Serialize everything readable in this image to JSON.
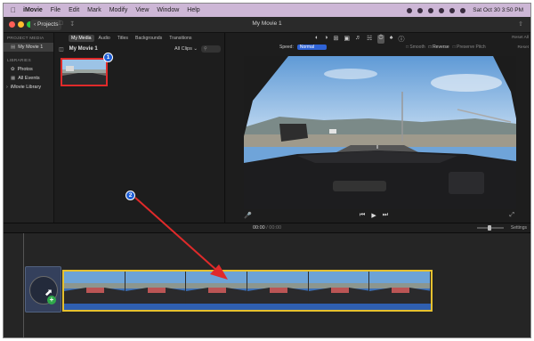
{
  "menubar": {
    "apple_icon": "apple-icon",
    "items": [
      "iMovie",
      "File",
      "Edit",
      "Mark",
      "Modify",
      "View",
      "Window",
      "Help"
    ],
    "clock": "Sat Oct 30  3:50 PM"
  },
  "titlebar": {
    "projects": "Projects",
    "title": "My Movie 1"
  },
  "sidebar": {
    "project_media_header": "PROJECT MEDIA",
    "project_item": "My Movie 1",
    "libraries_header": "LIBRARIES",
    "library_items": [
      "Photos",
      "All Events",
      "iMovie Library"
    ]
  },
  "browser": {
    "tabs": [
      "My Media",
      "Audio",
      "Titles",
      "Backgrounds",
      "Transitions"
    ],
    "title": "My Movie 1",
    "filter": "All Clips",
    "badge": "1"
  },
  "viewer": {
    "reset_all": "Reset All",
    "speed_label": "Speed:",
    "speed_value": "Normal",
    "options": [
      "Smooth",
      "Reverse",
      "Preserve Pitch"
    ],
    "reset": "Reset"
  },
  "timeline": {
    "timecode_current": "00:00",
    "timecode_total": "00:00",
    "settings": "Settings",
    "badge": "2"
  },
  "colors": {
    "menubar": "#cdb7d6",
    "selection_red": "#e02a2a",
    "clip_yellow": "#e6c12e",
    "badge_blue": "#1f5fd6"
  }
}
